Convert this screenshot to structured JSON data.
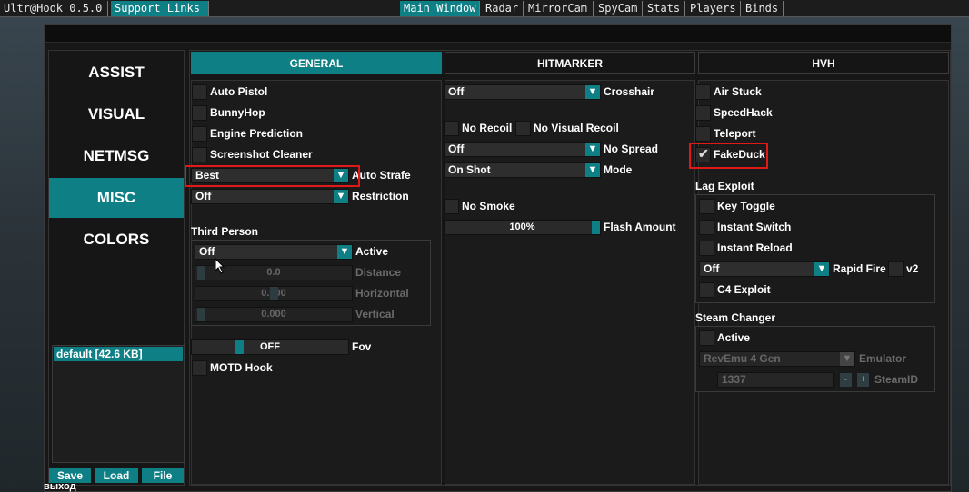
{
  "topbar": {
    "title": "Ultr@Hook 0.5.0",
    "support": "Support Links",
    "tabs": [
      "Main Window",
      "Radar",
      "MirrorCam",
      "SpyCam",
      "Stats",
      "Players",
      "Binds"
    ]
  },
  "sidebar": {
    "items": [
      "ASSIST",
      "VISUAL",
      "NETMSG",
      "MISC",
      "COLORS"
    ],
    "active": "MISC",
    "config": "default [42.6 KB]",
    "buttons": {
      "save": "Save",
      "load": "Load",
      "file": "File"
    }
  },
  "tabs": {
    "general": "GENERAL",
    "hitmarker": "HITMARKER",
    "hvh": "HVH"
  },
  "left": {
    "auto_pistol": "Auto Pistol",
    "bunnyhop": "BunnyHop",
    "engine_prediction": "Engine Prediction",
    "screenshot_cleaner": "Screenshot Cleaner",
    "auto_strafe_value": "Best",
    "auto_strafe": "Auto Strafe",
    "restriction_value": "Off",
    "restriction": "Restriction",
    "third_person": "Third Person",
    "tp_active_value": "Off",
    "tp_active": "Active",
    "distance_value": "0.0",
    "distance": "Distance",
    "horizontal_value": "0.000",
    "horizontal": "Horizontal",
    "vertical_value": "0.000",
    "vertical": "Vertical",
    "fov_value": "OFF",
    "fov": "Fov",
    "motd_hook": "MOTD Hook"
  },
  "middle": {
    "crosshair_value": "Off",
    "crosshair": "Crosshair",
    "no_recoil": "No Recoil",
    "no_visual_recoil": "No Visual Recoil",
    "no_spread_value": "Off",
    "no_spread": "No Spread",
    "mode_value": "On Shot",
    "mode": "Mode",
    "no_smoke": "No Smoke",
    "flash_value": "100%",
    "flash": "Flash Amount"
  },
  "right": {
    "air_stuck": "Air Stuck",
    "speedhack": "SpeedHack",
    "teleport": "Teleport",
    "fakeduck": "FakeDuck",
    "lag_exploit": "Lag Exploit",
    "key_toggle": "Key Toggle",
    "instant_switch": "Instant Switch",
    "instant_reload": "Instant Reload",
    "rapid_fire_value": "Off",
    "rapid_fire": "Rapid Fire",
    "v2": "v2",
    "c4_exploit": "C4 Exploit",
    "steam_changer": "Steam Changer",
    "sc_active": "Active",
    "emulator_value": "RevEmu 4 Gen",
    "emulator": "Emulator",
    "steamid_value": "1337",
    "steamid": "SteamID",
    "minus": "-",
    "plus": "+"
  },
  "footer": "выход"
}
